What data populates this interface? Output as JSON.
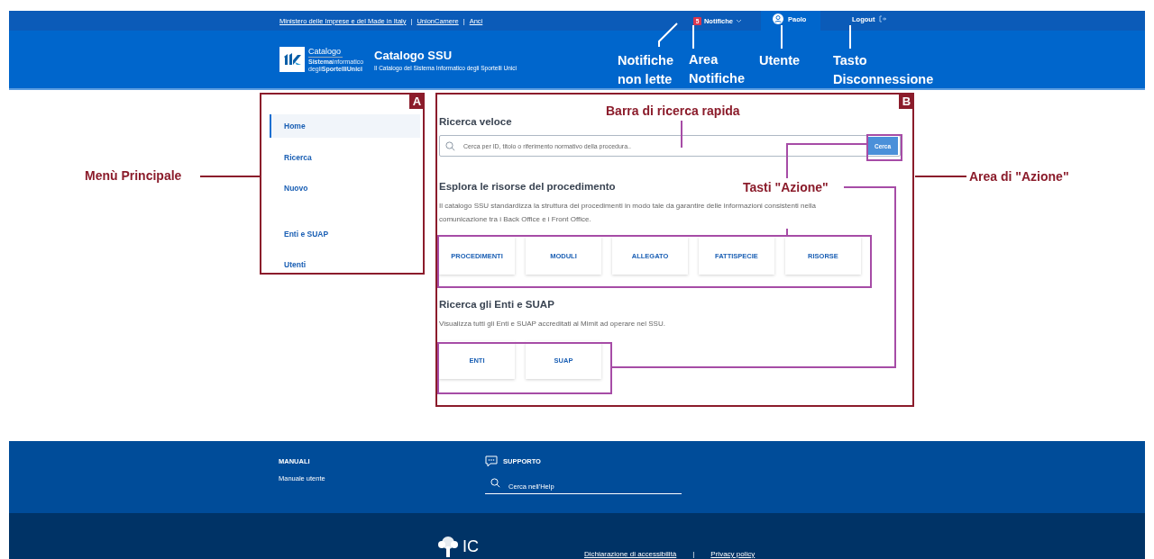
{
  "top_bar": {
    "links": [
      "Ministero delle Imprese e del Made in Italy",
      "UnionCamere",
      "Anci"
    ],
    "separator": "|",
    "notifications": {
      "count": "5",
      "label": "Notifiche"
    },
    "user": {
      "name": "Paolo",
      "selected": true
    },
    "logout": "Logout"
  },
  "header": {
    "logo": {
      "name": "Catalogo",
      "line1": "**Sistema**informatico",
      "line2": "degli**SportelliUnici**"
    },
    "title": "Catalogo SSU",
    "subtitle": "Il Catalogo del Sistema Informatico degli Sportelli Unici"
  },
  "sidebar": {
    "groups": [
      [
        {
          "label": "Home",
          "selected": true
        },
        {
          "label": "Ricerca",
          "selected": false
        },
        {
          "label": "Nuovo",
          "selected": false
        }
      ],
      [
        {
          "label": "Enti e SUAP",
          "selected": false
        },
        {
          "label": "Utenti",
          "selected": false
        }
      ]
    ]
  },
  "main": {
    "quick_search": {
      "title": "Ricerca veloce",
      "placeholder": "Cerca per ID, titolo o riferimento normativo della procedura..",
      "button": "Cerca"
    },
    "sections": [
      {
        "title": "Esplora le risorse del procedimento",
        "description": "Il catalogo SSU standardizza la struttura dei procedimenti in modo tale da garantire delle informazioni consistenti nella comunicazione tra i Back Office e i Front Office.",
        "buttons": [
          "PROCEDIMENTI",
          "MODULI",
          "ALLEGATO",
          "FATTISPECIE",
          "RISORSE"
        ]
      },
      {
        "title": "Ricerca gli Enti e SUAP",
        "description": "Visualizza tutti gli Enti e SUAP accreditati al Mimit ad operare nel SSU.",
        "buttons": [
          "ENTI",
          "SUAP"
        ]
      }
    ]
  },
  "footer": {
    "manuals": {
      "title": "MANUALI",
      "links": [
        "Manuale utente"
      ]
    },
    "support": {
      "title": "SUPPORTO",
      "search_placeholder": "Cerca nell'Help"
    }
  },
  "bottom_footer": {
    "logo_text": "IC",
    "links": [
      "Dichiarazione di accessibilità",
      "Privacy policy"
    ],
    "separator": "|"
  },
  "annotations": {
    "tags": [
      "A",
      "B"
    ],
    "labels": [
      {
        "text": "Notifiche\nnon lette"
      },
      {
        "text": "Area\nNotifiche"
      },
      {
        "text": "Utente"
      },
      {
        "text": "Tasto\nDisconnessione"
      },
      {
        "text": "Barra di ricerca rapida"
      },
      {
        "text": "Menù Principale"
      },
      {
        "text": "Area di \"Azione\""
      },
      {
        "text": "Tasti \"Azione\""
      }
    ]
  }
}
